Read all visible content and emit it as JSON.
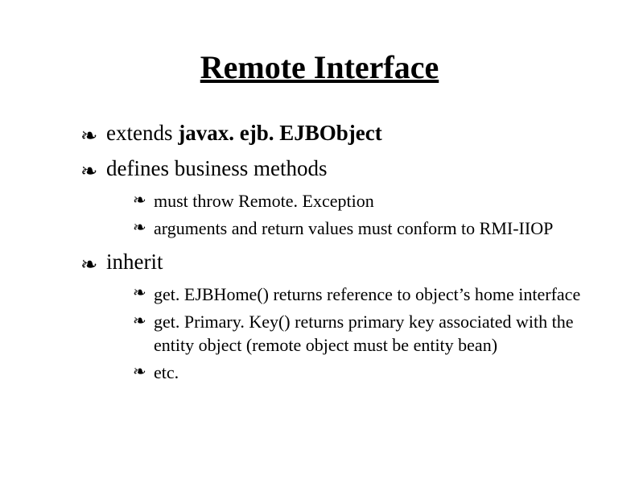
{
  "slide": {
    "title": "Remote Interface",
    "points": [
      {
        "prefix": "extends ",
        "bold": "javax. ejb. EJBObject",
        "children": []
      },
      {
        "prefix": "defines business methods",
        "bold": "",
        "children": [
          {
            "text": "must throw Remote. Exception"
          },
          {
            "text": "arguments and return values must conform to RMI-IIOP"
          }
        ]
      },
      {
        "prefix": "inherit",
        "bold": "",
        "children": [
          {
            "text": "get. EJBHome() returns reference to object’s home interface"
          },
          {
            "text": "get. Primary. Key() returns primary key associated with the entity object (remote object must be entity bean)"
          },
          {
            "text": "etc."
          }
        ]
      }
    ],
    "bullets": {
      "lvl1": "❧",
      "lvl2": "❧"
    }
  }
}
